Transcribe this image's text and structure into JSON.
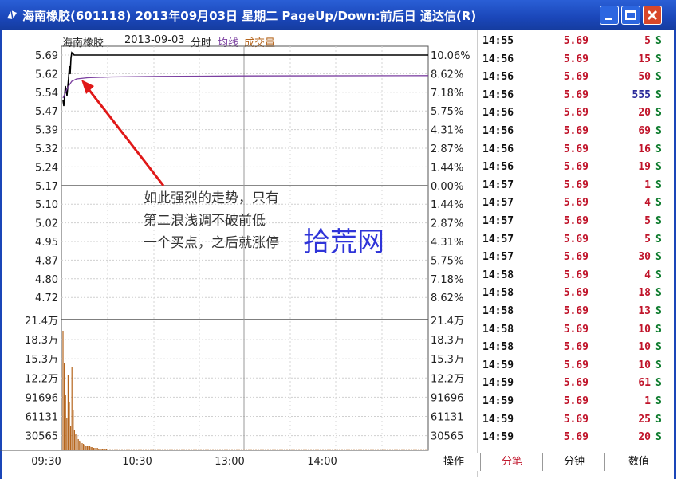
{
  "window": {
    "title": "海南橡胶(601118) 2013年09月03日 星期二 PageUp/Down:前后日 通达信(R)"
  },
  "chart_header": {
    "stock": "海南橡胶",
    "date": "2013-09-03",
    "mode": "分时",
    "avg_label": "均线",
    "vol_label": "成交量"
  },
  "colors": {
    "price_line": "#000000",
    "avg_line": "#7b3fa0",
    "volume_bar": "#b5651d",
    "up_red": "#c0142a",
    "down_green": "#0a7a2a",
    "arrow": "#e01818"
  },
  "price_axis_left": [
    "5.69",
    "5.62",
    "5.54",
    "5.47",
    "5.39",
    "5.32",
    "5.24",
    "5.17",
    "5.10",
    "5.02",
    "4.95",
    "4.87",
    "4.80",
    "4.72"
  ],
  "pct_axis_right": [
    "10.06%",
    "8.62%",
    "7.18%",
    "5.75%",
    "4.31%",
    "2.87%",
    "1.44%",
    "0.00%",
    "1.44%",
    "2.87%",
    "4.31%",
    "5.75%",
    "7.18%",
    "8.62%"
  ],
  "vol_axis_left": [
    "21.4万",
    "18.3万",
    "15.3万",
    "12.2万",
    "91696",
    "61131",
    "30565"
  ],
  "vol_axis_right": [
    "21.4万",
    "18.3万",
    "15.3万",
    "12.2万",
    "91696",
    "61131",
    "30565"
  ],
  "time_axis": [
    "09:30",
    "10:30",
    "13:00",
    "14:00"
  ],
  "annotation": {
    "lines": [
      "如此强烈的走势，只有",
      "第二浪浅调不破前低",
      "一个买点，之后就涨停"
    ]
  },
  "watermark": "拾荒网",
  "trades": [
    {
      "time": "14:55",
      "price": "5.69",
      "vol": "5",
      "side": "S"
    },
    {
      "time": "14:56",
      "price": "5.69",
      "vol": "15",
      "side": "S"
    },
    {
      "time": "14:56",
      "price": "5.69",
      "vol": "50",
      "side": "S"
    },
    {
      "time": "14:56",
      "price": "5.69",
      "vol": "555",
      "side": "S"
    },
    {
      "time": "14:56",
      "price": "5.69",
      "vol": "20",
      "side": "S"
    },
    {
      "time": "14:56",
      "price": "5.69",
      "vol": "69",
      "side": "S"
    },
    {
      "time": "14:56",
      "price": "5.69",
      "vol": "16",
      "side": "S"
    },
    {
      "time": "14:56",
      "price": "5.69",
      "vol": "19",
      "side": "S"
    },
    {
      "time": "14:57",
      "price": "5.69",
      "vol": "1",
      "side": "S"
    },
    {
      "time": "14:57",
      "price": "5.69",
      "vol": "4",
      "side": "S"
    },
    {
      "time": "14:57",
      "price": "5.69",
      "vol": "5",
      "side": "S"
    },
    {
      "time": "14:57",
      "price": "5.69",
      "vol": "5",
      "side": "S"
    },
    {
      "time": "14:57",
      "price": "5.69",
      "vol": "30",
      "side": "S"
    },
    {
      "time": "14:58",
      "price": "5.69",
      "vol": "4",
      "side": "S"
    },
    {
      "time": "14:58",
      "price": "5.69",
      "vol": "18",
      "side": "S"
    },
    {
      "time": "14:58",
      "price": "5.69",
      "vol": "13",
      "side": "S"
    },
    {
      "time": "14:58",
      "price": "5.69",
      "vol": "10",
      "side": "S"
    },
    {
      "time": "14:58",
      "price": "5.69",
      "vol": "10",
      "side": "S"
    },
    {
      "time": "14:59",
      "price": "5.69",
      "vol": "10",
      "side": "S"
    },
    {
      "time": "14:59",
      "price": "5.69",
      "vol": "61",
      "side": "S"
    },
    {
      "time": "14:59",
      "price": "5.69",
      "vol": "1",
      "side": "S"
    },
    {
      "time": "14:59",
      "price": "5.69",
      "vol": "25",
      "side": "S"
    },
    {
      "time": "14:59",
      "price": "5.69",
      "vol": "20",
      "side": "S"
    }
  ],
  "bottom_tabs": [
    "操作",
    "分笔",
    "分钟",
    "数值"
  ]
}
